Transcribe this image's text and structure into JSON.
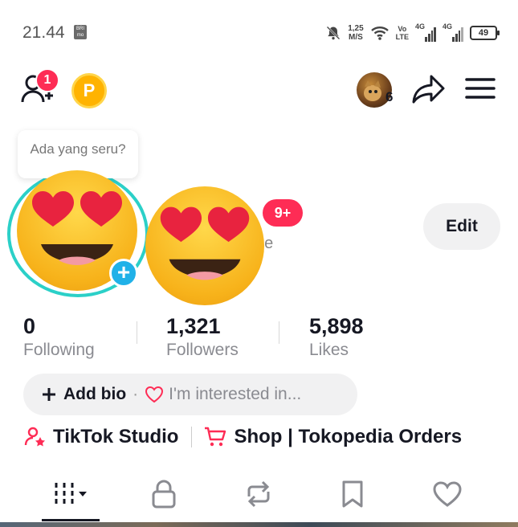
{
  "status_bar": {
    "time": "21.44",
    "bri_label": "BRI mo",
    "net_speed_value": "1,25",
    "net_speed_unit": "M/S",
    "volte_top": "Vo",
    "volte_bottom": "LTE",
    "signal_1": "4G",
    "signal_2": "4G",
    "battery": "49"
  },
  "header": {
    "friend_badge": "1",
    "coin_letter": "P",
    "avatar_count": "6"
  },
  "tooltip": {
    "text": "Ada yang seru?"
  },
  "profile": {
    "name_partial": "e",
    "notif_badge": "9+",
    "username_partial": "ee",
    "edit_label": "Edit"
  },
  "stats": [
    {
      "value": "0",
      "label": "Following"
    },
    {
      "value": "1,321",
      "label": "Followers"
    },
    {
      "value": "5,898",
      "label": "Likes"
    }
  ],
  "bio": {
    "add_label": "Add bio",
    "separator": "·",
    "interest_label": "I'm interested in..."
  },
  "links": {
    "studio": "TikTok Studio",
    "shop": "Shop | Tokopedia Orders"
  },
  "tabs": [
    {
      "icon": "videos-grid-icon"
    },
    {
      "icon": "lock-icon"
    },
    {
      "icon": "repost-icon"
    },
    {
      "icon": "bookmark-icon"
    },
    {
      "icon": "heart-icon"
    }
  ],
  "colors": {
    "accent": "#fe2c55",
    "ring": "#2bd0c8",
    "plus": "#20b1e8",
    "coin": "#ffb300"
  }
}
